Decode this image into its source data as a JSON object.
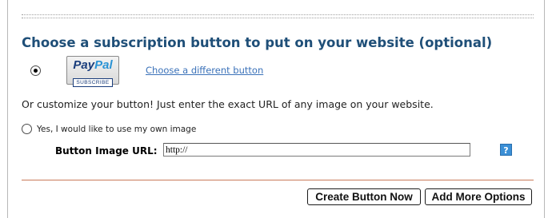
{
  "heading": "Choose a subscription button to put on your website (optional)",
  "paypal_button": {
    "logo_part1": "Pay",
    "logo_part2": "Pal",
    "label": "SUBSCRIBE",
    "selected": true
  },
  "choose_different_link": "Choose a different button",
  "customize_text": "Or customize your button! Just enter the exact URL of any image on your website.",
  "own_image_radio": {
    "label": "Yes, I would like to use my own image",
    "selected": false
  },
  "button_image_url": {
    "label": "Button Image URL:",
    "value": "http://"
  },
  "help_icon": {
    "glyph": "?",
    "color": "#3b8fd6"
  },
  "buttons": {
    "create": "Create Button Now",
    "add_more": "Add More Options"
  },
  "colors": {
    "heading": "#1f4f78",
    "link": "#3b72b9"
  }
}
